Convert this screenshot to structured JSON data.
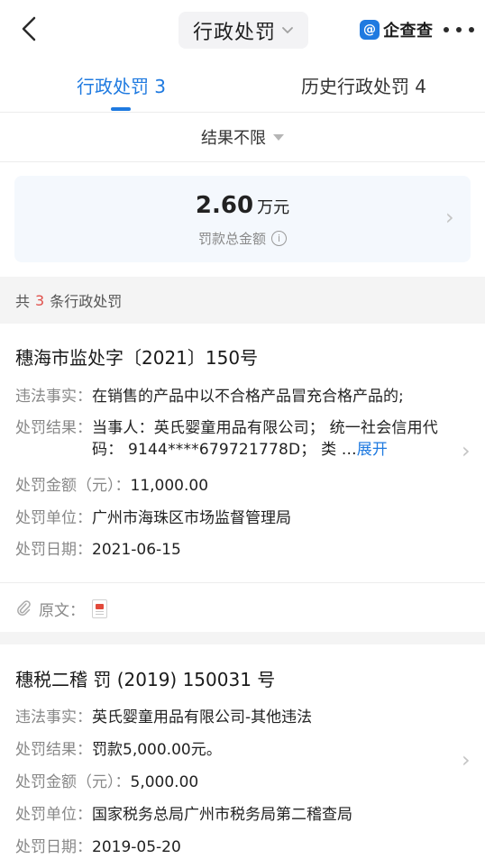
{
  "header": {
    "title": "行政处罚",
    "brand": "企查查",
    "brand_logo_char": "@"
  },
  "tabs": [
    {
      "label": "行政处罚 3",
      "active": true
    },
    {
      "label": "历史行政处罚 4",
      "active": false
    }
  ],
  "filter": {
    "label": "结果不限"
  },
  "summary": {
    "amount": "2.60",
    "unit": "万元",
    "label": "罚款总金额",
    "info_icon": "i"
  },
  "count": {
    "prefix": "共",
    "num": "3",
    "suffix": "条行政处罚"
  },
  "records": [
    {
      "title": "穗海市监处字〔2021〕150号",
      "fields": [
        {
          "label": "违法事实：",
          "value": "在销售的产品中以不合格产品冒充合格产品的;"
        },
        {
          "label": "处罚结果：",
          "value": "当事人：英氏婴童用品有限公司； 统一社会信用代码： 9144****679721778D；  类 ...",
          "expand": "展开"
        },
        {
          "label": "处罚金额（元）：",
          "value": "11,000.00"
        },
        {
          "label": "处罚单位：",
          "value": "广州市海珠区市场监督管理局"
        },
        {
          "label": "处罚日期：",
          "value": "2021-06-15"
        }
      ],
      "original_label": "原文："
    },
    {
      "title": "穗税二稽 罚 (2019) 150031 号",
      "fields": [
        {
          "label": "违法事实：",
          "value": "英氏婴童用品有限公司-其他违法"
        },
        {
          "label": "处罚结果：",
          "value": "罚款5,000.00元。"
        },
        {
          "label": "处罚金额（元）：",
          "value": "5,000.00"
        },
        {
          "label": "处罚单位：",
          "value": "国家税务总局广州市税务局第二稽查局"
        },
        {
          "label": "处罚日期：",
          "value": "2019-05-20"
        }
      ]
    }
  ],
  "colors": {
    "accent": "#1f7ae0",
    "count_highlight": "#e0504b"
  }
}
